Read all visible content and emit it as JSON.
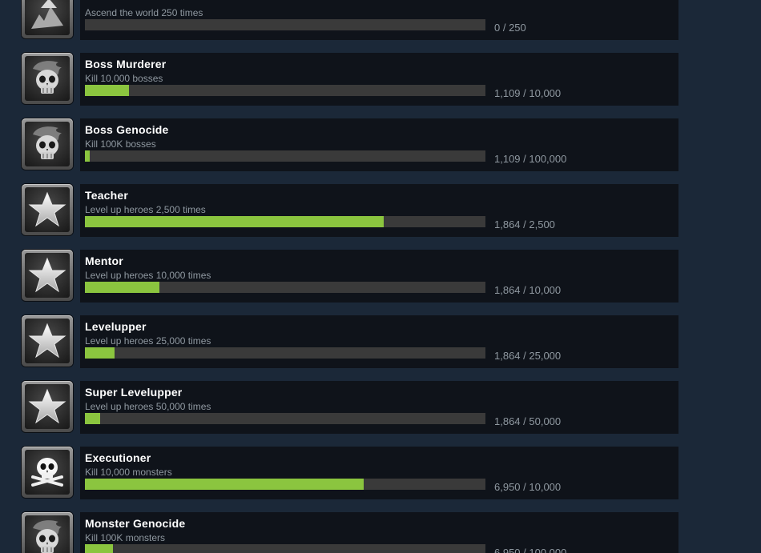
{
  "achievements": [
    {
      "title": "",
      "description": "Ascend the world 250 times",
      "progress_text": "0 / 250",
      "progress_fraction": 0.0,
      "icon": "ascend-icon"
    },
    {
      "title": "Boss Murderer",
      "description": "Kill 10,000 bosses",
      "progress_text": "1,109 / 10,000",
      "progress_fraction": 0.1109,
      "icon": "ghost-skull-icon"
    },
    {
      "title": "Boss Genocide",
      "description": "Kill 100K bosses",
      "progress_text": "1,109 / 100,000",
      "progress_fraction": 0.01109,
      "icon": "ghost-skull-icon"
    },
    {
      "title": "Teacher",
      "description": "Level up heroes 2,500 times",
      "progress_text": "1,864 / 2,500",
      "progress_fraction": 0.7456,
      "icon": "star-icon"
    },
    {
      "title": "Mentor",
      "description": "Level up heroes 10,000 times",
      "progress_text": "1,864 / 10,000",
      "progress_fraction": 0.1864,
      "icon": "star-icon"
    },
    {
      "title": "Levelupper",
      "description": "Level up heroes 25,000 times",
      "progress_text": "1,864 / 25,000",
      "progress_fraction": 0.07456,
      "icon": "star-icon"
    },
    {
      "title": "Super Levelupper",
      "description": "Level up heroes 50,000 times",
      "progress_text": "1,864 / 50,000",
      "progress_fraction": 0.03728,
      "icon": "star-icon"
    },
    {
      "title": "Executioner",
      "description": "Kill 10,000 monsters",
      "progress_text": "6,950 / 10,000",
      "progress_fraction": 0.695,
      "icon": "skull-crossbones-icon"
    },
    {
      "title": "Monster Genocide",
      "description": "Kill 100K monsters",
      "progress_text": "6,950 / 100,000",
      "progress_fraction": 0.0695,
      "icon": "ghost-skull-icon"
    }
  ],
  "colors": {
    "background": "#1b2838",
    "panel": "#0f131a",
    "progress_fill": "#8bc53f",
    "progress_track": "#3a3a3a",
    "title_text": "#ffffff",
    "muted_text": "#8f98a0"
  }
}
